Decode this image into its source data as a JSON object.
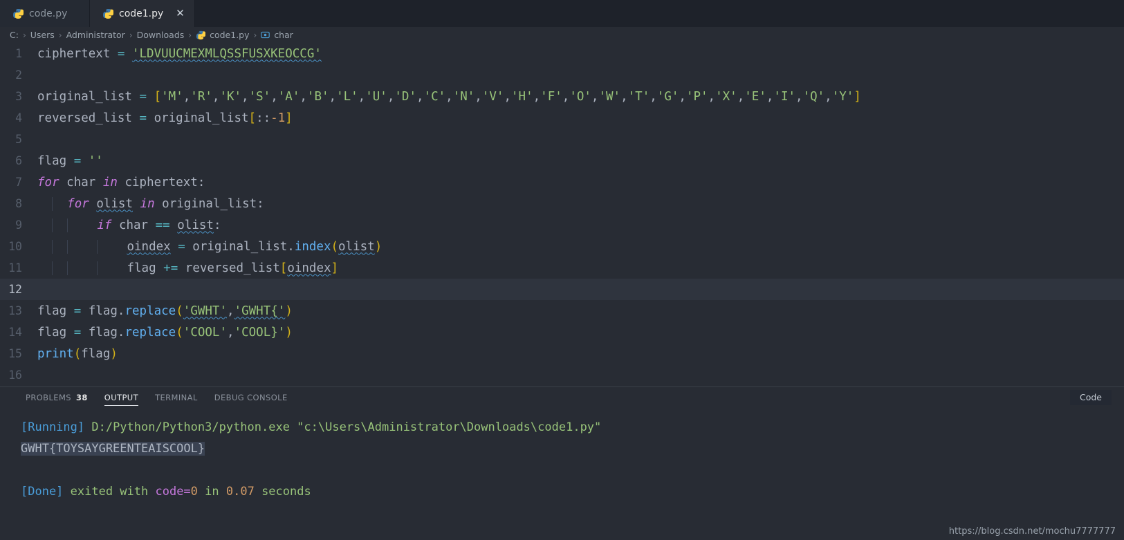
{
  "window": {
    "background": "#282c34",
    "tabbar_background": "#1e222a"
  },
  "tabs": [
    {
      "label": "code.py",
      "icon": "python-icon",
      "active": false,
      "closable": false
    },
    {
      "label": "code1.py",
      "icon": "python-icon",
      "active": true,
      "closable": true,
      "close_glyph": "✕"
    }
  ],
  "breadcrumb": {
    "separator": "›",
    "items": [
      {
        "label": "C:",
        "icon": null
      },
      {
        "label": "Users",
        "icon": null
      },
      {
        "label": "Administrator",
        "icon": null
      },
      {
        "label": "Downloads",
        "icon": null
      },
      {
        "label": "code1.py",
        "icon": "python-icon"
      },
      {
        "label": "char",
        "icon": "symbol-variable-icon"
      }
    ]
  },
  "editor": {
    "language": "python",
    "active_line": 12,
    "lines": [
      {
        "n": "1",
        "text": "ciphertext = 'LDVUUCMEXMLQSSFUSXKEOCCG'"
      },
      {
        "n": "2",
        "text": ""
      },
      {
        "n": "3",
        "text": "original_list = ['M','R','K','S','A','B','L','U','D','C','N','V','H','F','O','W','T','G','P','X','E','I','Q','Y']"
      },
      {
        "n": "4",
        "text": "reversed_list = original_list[::-1]"
      },
      {
        "n": "5",
        "text": ""
      },
      {
        "n": "6",
        "text": "flag = ''"
      },
      {
        "n": "7",
        "text": "for char in ciphertext:"
      },
      {
        "n": "8",
        "text": "    for olist in original_list:"
      },
      {
        "n": "9",
        "text": "        if char == olist:"
      },
      {
        "n": "10",
        "text": "            oindex = original_list.index(olist)"
      },
      {
        "n": "11",
        "text": "            flag += reversed_list[oindex]"
      },
      {
        "n": "12",
        "text": ""
      },
      {
        "n": "13",
        "text": "flag = flag.replace('GWHT','GWHT{')"
      },
      {
        "n": "14",
        "text": "flag = flag.replace('COOL','COOL}')"
      },
      {
        "n": "15",
        "text": "print(flag)"
      },
      {
        "n": "16",
        "text": ""
      }
    ],
    "line_numbers": [
      "1",
      "2",
      "3",
      "4",
      "5",
      "6",
      "7",
      "8",
      "9",
      "10",
      "11",
      "12",
      "13",
      "14",
      "15",
      "16"
    ],
    "tokens": {
      "ciphertext_name": "ciphertext",
      "ciphertext_value": "'LDVUUCMEXMLQSSFUSXKEOCCG'",
      "original_list_name": "original_list",
      "original_list_items": [
        "'M'",
        "'R'",
        "'K'",
        "'S'",
        "'A'",
        "'B'",
        "'L'",
        "'U'",
        "'D'",
        "'C'",
        "'N'",
        "'V'",
        "'H'",
        "'F'",
        "'O'",
        "'W'",
        "'T'",
        "'G'",
        "'P'",
        "'X'",
        "'E'",
        "'I'",
        "'Q'",
        "'Y'"
      ],
      "reversed_list_name": "reversed_list",
      "slice_expr": "original_list[::-1]",
      "flag_name": "flag",
      "empty_string": "''",
      "kw_for": "for",
      "kw_in": "in",
      "kw_if": "if",
      "var_char": "char",
      "var_olist": "olist",
      "var_oindex": "oindex",
      "fn_index": "index",
      "fn_replace": "replace",
      "fn_print": "print",
      "replace1_from": "'GWHT'",
      "replace1_to": "'GWHT{'",
      "replace2_from": "'COOL'",
      "replace2_to": "'COOL}'",
      "op_assign": "=",
      "op_eq": "==",
      "op_plus_assign": "+=",
      "num_minus1": "1"
    },
    "colors": {
      "background": "#282c34",
      "text": "#abb2bf",
      "keyword": "#c678dd",
      "string": "#98c379",
      "function": "#61afef",
      "operator": "#56b6c2",
      "number": "#d19a66",
      "bracket_yellow": "#d5b318",
      "line_number": "#565e6b",
      "active_line_number": "#b9c0cb",
      "squiggle": "#4a90c2"
    }
  },
  "panel": {
    "tabs": [
      {
        "label": "PROBLEMS",
        "badge": "38",
        "active": false
      },
      {
        "label": "OUTPUT",
        "badge": null,
        "active": true
      },
      {
        "label": "TERMINAL",
        "badge": null,
        "active": false
      },
      {
        "label": "DEBUG CONSOLE",
        "badge": null,
        "active": false
      }
    ],
    "code_pill_label": "Code",
    "output": {
      "running_tag": "[Running]",
      "running_command": " D:/Python/Python3/python.exe \"c:\\Users\\Administrator\\Downloads\\code1.py\"",
      "result_selected": "GWHT{TOYSAYGREENTEAISCOOL}",
      "result_is_selected": true,
      "done_tag": "[Done]",
      "done_mid": " exited with ",
      "done_code_label": "code=",
      "done_code_value": "0",
      "done_tail": " in ",
      "done_duration": "0.07",
      "done_unit": " seconds"
    },
    "colors": {
      "tag": "#4a9eda",
      "stdout": "#98c379",
      "selection": "#3a4252",
      "magenta": "#c678dd",
      "number": "#d19a66"
    }
  },
  "watermark": {
    "text": "https://blog.csdn.net/mochu7777777"
  }
}
